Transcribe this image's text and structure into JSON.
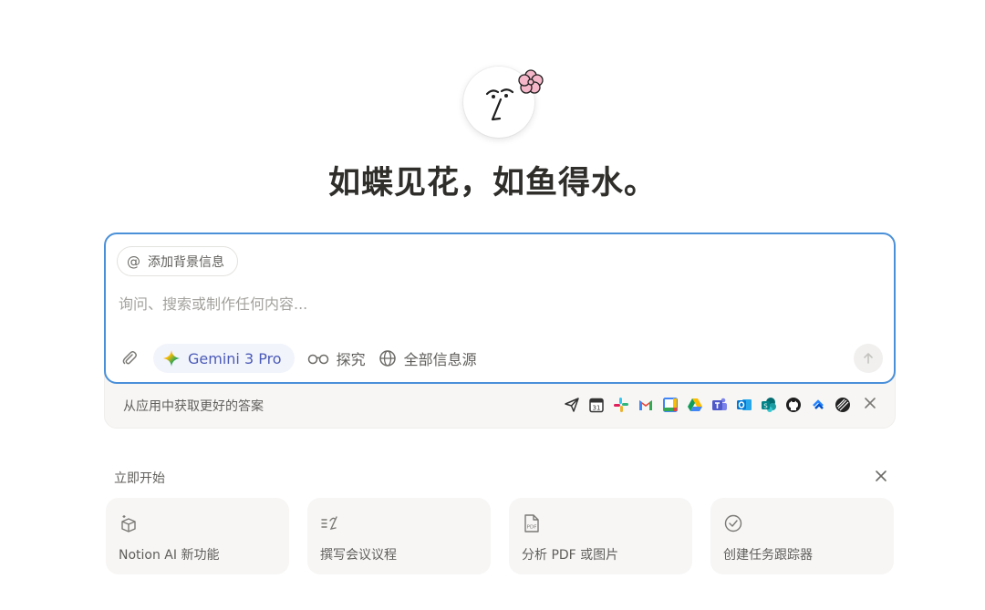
{
  "headline": "如蝶见花，如鱼得水。",
  "composer": {
    "context_chip_label": "添加背景信息",
    "context_chip_icon": "@",
    "placeholder": "询问、搜索或制作任何内容...",
    "model_label": "Gemini 3 Pro",
    "explore_label": "探究",
    "sources_label": "全部信息源"
  },
  "apps_bar": {
    "label": "从应用中获取更好的答案",
    "icons": [
      "send-icon",
      "calendar-icon",
      "slack-icon",
      "gmail-icon",
      "google-calendar-icon",
      "google-drive-icon",
      "teams-icon",
      "outlook-icon",
      "sharepoint-icon",
      "github-icon",
      "jira-icon",
      "linear-icon"
    ],
    "calendar_day": "31"
  },
  "quick_start": {
    "title": "立即开始",
    "cards": [
      {
        "icon": "box-sparkle-icon",
        "label": "Notion AI 新功能"
      },
      {
        "icon": "meeting-notes-icon",
        "label": "撰写会议议程"
      },
      {
        "icon": "pdf-file-icon",
        "label": "分析 PDF 或图片",
        "icon_text": "PDF"
      },
      {
        "icon": "check-circle-icon",
        "label": "创建任务跟踪器"
      }
    ]
  },
  "colors": {
    "accent_border": "#4a90d9",
    "model_text": "#4b5bb8",
    "flower": "#f4b6c8"
  }
}
